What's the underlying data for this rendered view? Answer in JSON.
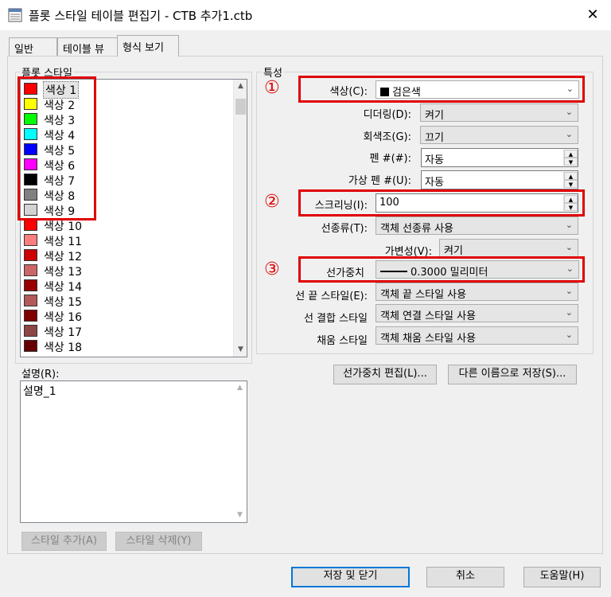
{
  "window": {
    "title": "플롯 스타일 테이블 편집기 - CTB 추가1.ctb",
    "close_glyph": "✕"
  },
  "tabs": [
    {
      "label": "일반"
    },
    {
      "label": "테이블 뷰"
    },
    {
      "label": "형식 보기"
    }
  ],
  "left": {
    "styles_group_label": "플롯 스타일",
    "styles": [
      {
        "label": "색상 1",
        "color": "#ff0000"
      },
      {
        "label": "색상 2",
        "color": "#ffff00"
      },
      {
        "label": "색상 3",
        "color": "#00ff00"
      },
      {
        "label": "색상 4",
        "color": "#00ffff"
      },
      {
        "label": "색상 5",
        "color": "#0000ff"
      },
      {
        "label": "색상 6",
        "color": "#ff00ff"
      },
      {
        "label": "색상 7",
        "color": "#000000"
      },
      {
        "label": "색상 8",
        "color": "#808080"
      },
      {
        "label": "색상 9",
        "color": "#d3d3d3"
      },
      {
        "label": "색상 10",
        "color": "#ff0000"
      },
      {
        "label": "색상 11",
        "color": "#ff7f7f"
      },
      {
        "label": "색상 12",
        "color": "#cc0000"
      },
      {
        "label": "색상 13",
        "color": "#cc6666"
      },
      {
        "label": "색상 14",
        "color": "#990000"
      },
      {
        "label": "색상 15",
        "color": "#b25959"
      },
      {
        "label": "색상 16",
        "color": "#800000"
      },
      {
        "label": "색상 17",
        "color": "#8c4646"
      },
      {
        "label": "색상 18",
        "color": "#660000"
      }
    ],
    "description_label": "설명(R):",
    "description_value": "설명_1",
    "add_style_label": "스타일 추가(A)",
    "delete_style_label": "스타일 삭제(Y)"
  },
  "properties": {
    "group_label": "특성",
    "color": {
      "label": "색상(C):",
      "value": "검은색",
      "swatch": "#000000"
    },
    "dither": {
      "label": "디더링(D):",
      "value": "켜기"
    },
    "grayscale": {
      "label": "회색조(G):",
      "value": "끄기"
    },
    "pen": {
      "label": "펜 #(#):",
      "value": "자동"
    },
    "virtual_pen": {
      "label": "가상 펜 #(U):",
      "value": "자동"
    },
    "screening": {
      "label": "스크리닝(I):",
      "value": "100"
    },
    "linetype": {
      "label": "선종류(T):",
      "value": "객체 선종류 사용"
    },
    "adaptive": {
      "label": "가변성(V):",
      "value": "켜기"
    },
    "lineweight": {
      "label": "선가중치",
      "value": "0.3000 밀리미터"
    },
    "line_end": {
      "label": "선 끝 스타일(E):",
      "value": "객체 끝 스타일 사용"
    },
    "line_join": {
      "label": "선 결합 스타일",
      "value": "객체 연결 스타일 사용"
    },
    "fill": {
      "label": "채움 스타일",
      "value": "객체 채움 스타일 사용"
    },
    "edit_lineweights_label": "선가중치 편집(L)...",
    "save_as_label": "다른 이름으로 저장(S)..."
  },
  "annotations": {
    "marker1": "①",
    "marker2": "②",
    "marker3": "③",
    "accent": "#e00000"
  },
  "footer": {
    "save_close_label": "저장 및 닫기",
    "cancel_label": "취소",
    "help_label": "도움말(H)"
  }
}
